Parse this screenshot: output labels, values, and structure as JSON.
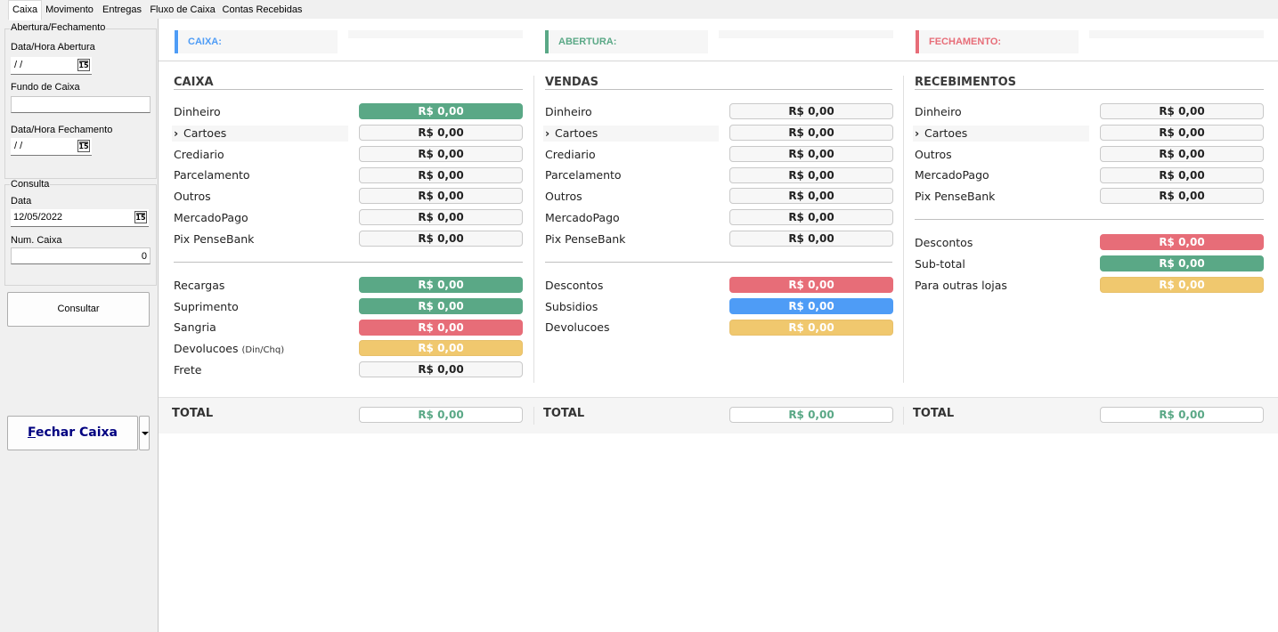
{
  "tabs": [
    "Caixa",
    "Movimento",
    "Entregas",
    "Fluxo de Caixa",
    "Contas Recebidas"
  ],
  "left": {
    "group1_title": "Abertura/Fechamento",
    "abertura_label": "Data/Hora Abertura",
    "abertura_value": " /  /",
    "fundo_label": "Fundo de Caixa",
    "fundo_value": "",
    "fechamento_label": "Data/Hora Fechamento",
    "fechamento_value": " /  /",
    "group2_title": "Consulta",
    "data_label": "Data",
    "data_value": "12/05/2022",
    "numcaixa_label": "Num. Caixa",
    "numcaixa_value": "0",
    "consultar_label": "Consultar",
    "fechar_label": "Fechar Caixa",
    "fechar_accel": "F",
    "fechar_rest": "echar Caixa",
    "calendar_icon": "15"
  },
  "header": {
    "caixa": "CAIXA:",
    "abertura": "ABERTURA:",
    "fechamento": "FECHAMENTO:"
  },
  "colors": {
    "green": "#5aa886",
    "red": "#e76d78",
    "yellow": "#f0c86e",
    "blue": "#4e9cf6",
    "caixa_accent": "#4e9cf6",
    "abertura_accent": "#5aa886",
    "fechamento_accent": "#e76d78"
  },
  "caixa": {
    "title": "CAIXA",
    "rows": [
      {
        "label": "Dinheiro",
        "value": "R$ 0,00"
      },
      {
        "label": "Cartoes",
        "value": "R$ 0,00"
      },
      {
        "label": "Crediario",
        "value": "R$ 0,00"
      },
      {
        "label": "Parcelamento",
        "value": "R$ 0,00"
      },
      {
        "label": "Outros",
        "value": "R$ 0,00"
      },
      {
        "label": "MercadoPago",
        "value": "R$ 0,00"
      },
      {
        "label": "Pix PenseBank",
        "value": "R$ 0,00"
      }
    ],
    "rows2": [
      {
        "label": "Recargas",
        "value": "R$ 0,00"
      },
      {
        "label": "Suprimento",
        "value": "R$ 0,00"
      },
      {
        "label": "Sangria",
        "value": "R$ 0,00"
      },
      {
        "label": "Devolucoes",
        "note": "(Din/Chq)",
        "value": "R$ 0,00"
      },
      {
        "label": "Frete",
        "value": "R$ 0,00"
      }
    ]
  },
  "vendas": {
    "title": "VENDAS",
    "rows": [
      {
        "label": "Dinheiro",
        "value": "R$ 0,00"
      },
      {
        "label": "Cartoes",
        "value": "R$ 0,00"
      },
      {
        "label": "Crediario",
        "value": "R$ 0,00"
      },
      {
        "label": "Parcelamento",
        "value": "R$ 0,00"
      },
      {
        "label": "Outros",
        "value": "R$ 0,00"
      },
      {
        "label": "MercadoPago",
        "value": "R$ 0,00"
      },
      {
        "label": "Pix PenseBank",
        "value": "R$ 0,00"
      }
    ],
    "rows2": [
      {
        "label": "Descontos",
        "value": "R$ 0,00"
      },
      {
        "label": "Subsidios",
        "value": "R$ 0,00"
      },
      {
        "label": "Devolucoes",
        "value": "R$ 0,00"
      }
    ]
  },
  "recebimentos": {
    "title": "RECEBIMENTOS",
    "rows": [
      {
        "label": "Dinheiro",
        "value": "R$ 0,00"
      },
      {
        "label": "Cartoes",
        "value": "R$ 0,00"
      },
      {
        "label": "Outros",
        "value": "R$ 0,00"
      },
      {
        "label": "MercadoPago",
        "value": "R$ 0,00"
      },
      {
        "label": "Pix PenseBank",
        "value": "R$ 0,00"
      }
    ],
    "rows2": [
      {
        "label": "Descontos",
        "value": "R$ 0,00"
      },
      {
        "label": "Sub-total",
        "value": "R$ 0,00"
      },
      {
        "label": "Para outras lojas",
        "value": "R$ 0,00"
      }
    ]
  },
  "totals": {
    "label": "TOTAL",
    "caixa": "R$ 0,00",
    "vendas": "R$ 0,00",
    "recebimentos": "R$ 0,00"
  },
  "chevron_icon": "›"
}
